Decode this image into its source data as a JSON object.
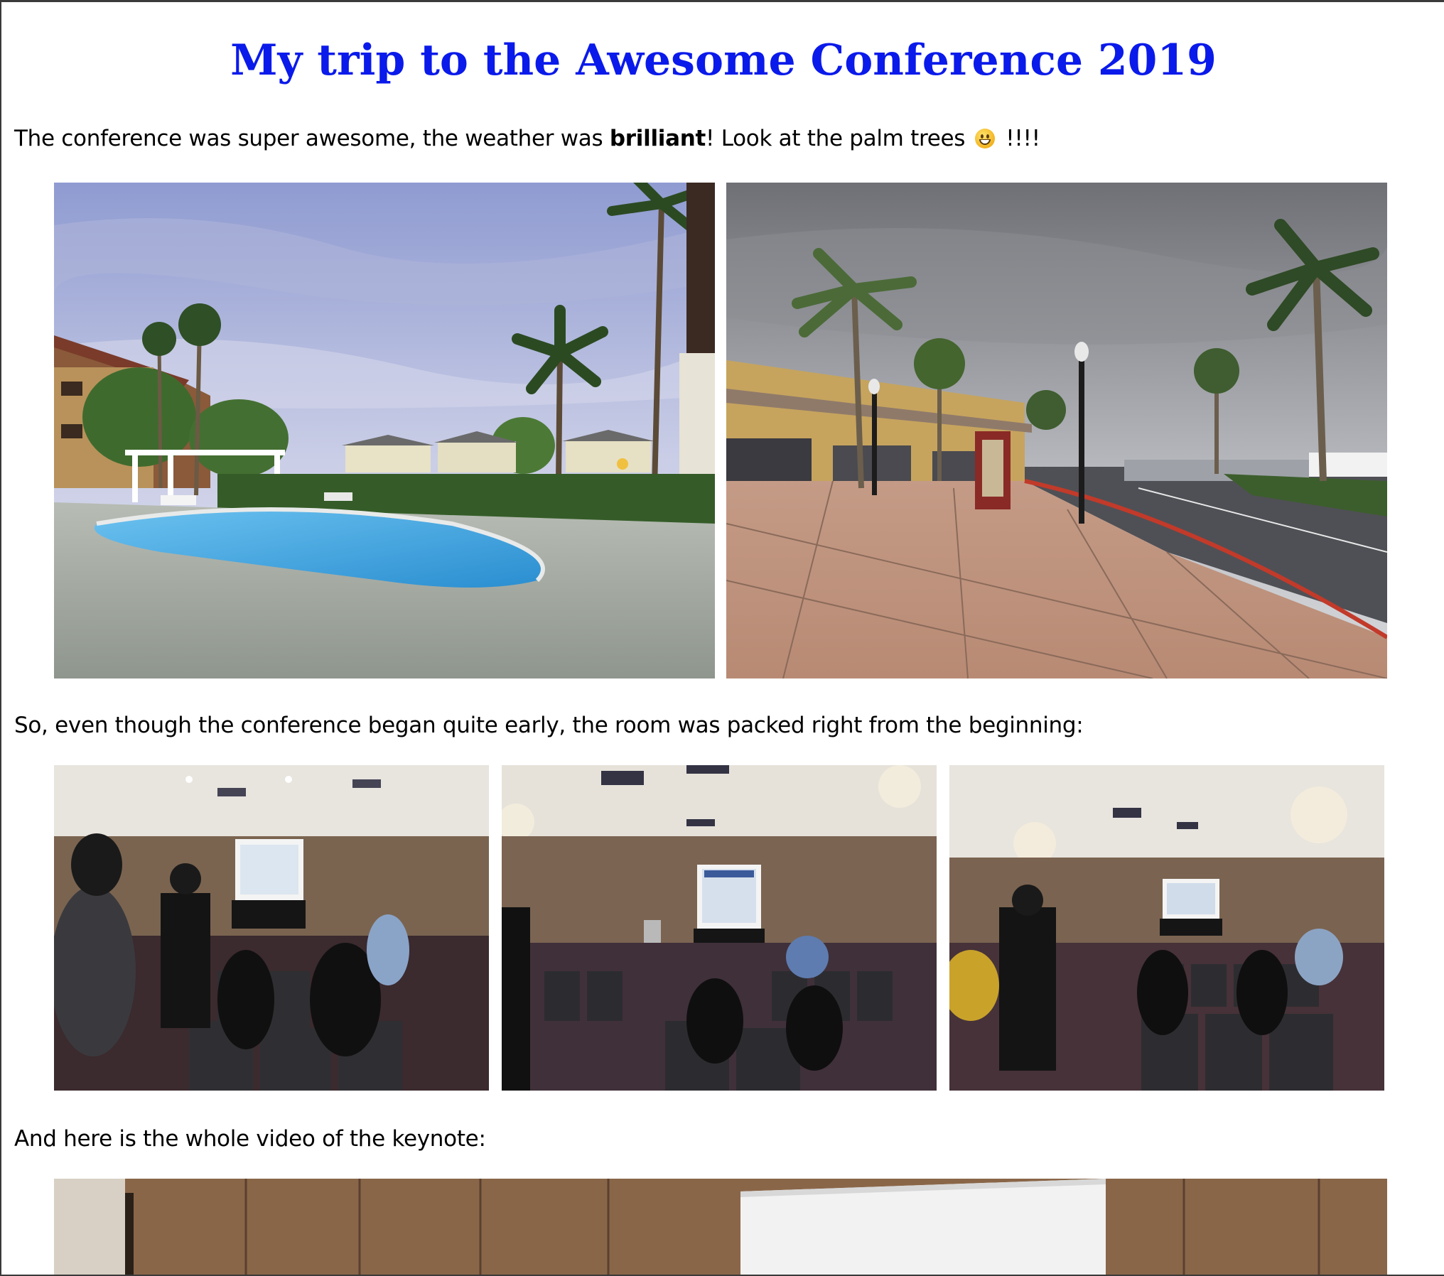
{
  "page": {
    "title": "My trip to the Awesome Conference 2019",
    "intro": {
      "before": "The conference was super awesome, the weather was ",
      "bold": "brilliant",
      "after": "! Look at the palm trees ",
      "emoji": "grinning-face-icon",
      "after_emoji": " !!!!"
    },
    "room_caption": "So, even though the conference began quite early, the room was packed right from the beginning:",
    "video_caption": "And here is the whole video of the keynote:"
  },
  "colors": {
    "title": "#0a1aea",
    "text": "#000000",
    "background": "#ffffff"
  },
  "images": {
    "pool": "hotel pool with palm trees",
    "plaza": "shopping plaza with palm trees and lamp posts",
    "room1": "conference room with audience and projector screen",
    "room2": "conference room wide view with projector screen",
    "room3": "conference room from the side with projector screen",
    "video": "keynote video still"
  }
}
